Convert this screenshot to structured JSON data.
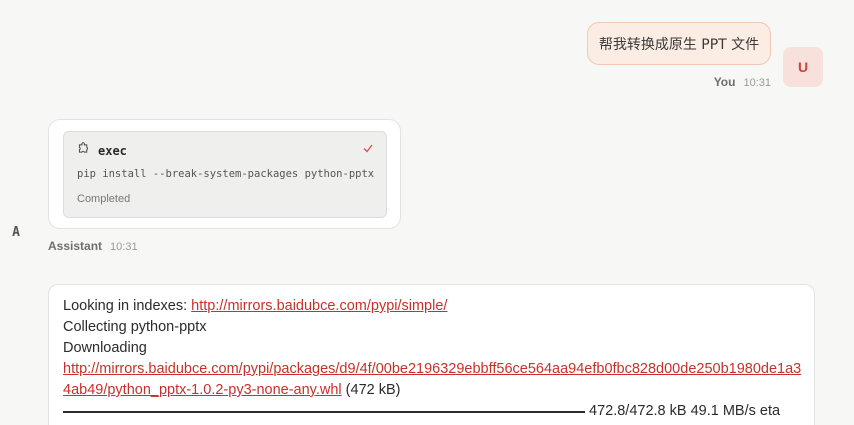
{
  "user_message": {
    "text": "帮我转换成原生 PPT 文件",
    "avatar_letter": "U",
    "author": "You",
    "time": "10:31"
  },
  "tool_call": {
    "icon": "puzzle-icon",
    "title": "exec",
    "command": "pip install --break-system-packages python-pptx",
    "status": "Completed",
    "status_icon": "check-icon"
  },
  "assistant": {
    "avatar_letter": "A",
    "author": "Assistant",
    "time": "10:31"
  },
  "log": {
    "line1_prefix": "Looking in indexes: ",
    "line1_link": "http://mirrors.baidubce.com/pypi/simple/",
    "line2": "Collecting python-pptx",
    "line3": "Downloading",
    "download_link": "http://mirrors.baidubce.com/pypi/packages/d9/4f/00be2196329ebbff56ce564aa94efb0fbc828d00de250b1980de1a34ab49/python_pptx-1.0.2-py3-none-any.whl",
    "download_size": " (472 kB)",
    "progress_text": "472.8/472.8 kB 49.1 MB/s eta",
    "progress_fraction": 1.0
  },
  "colors": {
    "accent": "#c9302c",
    "user_bubble_bg": "#fbede4",
    "page_bg": "#f7f7f6"
  }
}
